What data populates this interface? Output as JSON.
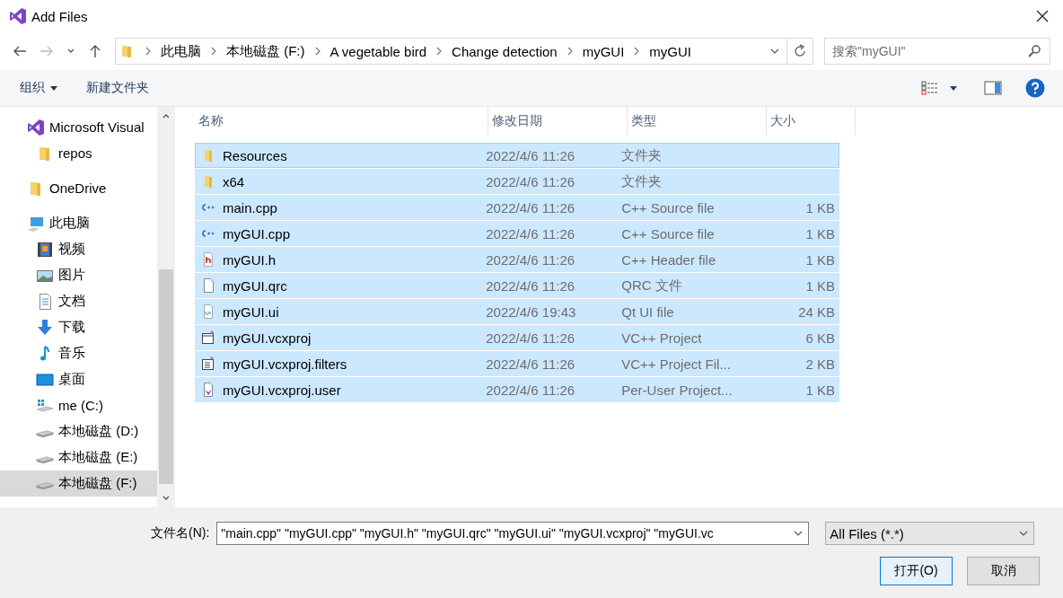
{
  "window": {
    "title": "Add Files"
  },
  "address": {
    "crumbs": [
      "此电脑",
      "本地磁盘 (F:)",
      "A vegetable bird",
      "Change detection",
      "myGUI",
      "myGUI"
    ]
  },
  "search": {
    "placeholder": "搜索\"myGUI\""
  },
  "toolbar": {
    "organize": "组织",
    "new_folder": "新建文件夹"
  },
  "sidebar": {
    "items": [
      {
        "label": "Microsoft Visual",
        "kind": "vs",
        "selected": false,
        "children": [
          {
            "label": "repos",
            "kind": "folder",
            "selected": false
          }
        ]
      },
      {
        "label": "OneDrive",
        "kind": "folder",
        "selected": false
      },
      {
        "label": "此电脑",
        "kind": "pc",
        "selected": false,
        "children": [
          {
            "label": "视频",
            "kind": "video",
            "selected": false
          },
          {
            "label": "图片",
            "kind": "picture",
            "selected": false
          },
          {
            "label": "文档",
            "kind": "doc",
            "selected": false
          },
          {
            "label": "下载",
            "kind": "download",
            "selected": false
          },
          {
            "label": "音乐",
            "kind": "music",
            "selected": false
          },
          {
            "label": "桌面",
            "kind": "desktop",
            "selected": false
          },
          {
            "label": "me (C:)",
            "kind": "windrive",
            "selected": false
          },
          {
            "label": "本地磁盘 (D:)",
            "kind": "drive",
            "selected": false
          },
          {
            "label": "本地磁盘 (E:)",
            "kind": "drive",
            "selected": false
          },
          {
            "label": "本地磁盘 (F:)",
            "kind": "drive",
            "selected": true
          }
        ]
      }
    ]
  },
  "table": {
    "columns": [
      "名称",
      "修改日期",
      "类型",
      "大小"
    ],
    "rows": [
      {
        "name": "Resources",
        "kind": "folder",
        "date": "2022/4/6 11:26",
        "type": "文件夹",
        "size": "",
        "selected": true
      },
      {
        "name": "x64",
        "kind": "folder",
        "date": "2022/4/6 11:26",
        "type": "文件夹",
        "size": "",
        "selected": true
      },
      {
        "name": "main.cpp",
        "kind": "cpp",
        "date": "2022/4/6 11:26",
        "type": "C++ Source file",
        "size": "1 KB",
        "selected": true
      },
      {
        "name": "myGUI.cpp",
        "kind": "cpp",
        "date": "2022/4/6 11:26",
        "type": "C++ Source file",
        "size": "1 KB",
        "selected": true
      },
      {
        "name": "myGUI.h",
        "kind": "h",
        "date": "2022/4/6 11:26",
        "type": "C++ Header file",
        "size": "1 KB",
        "selected": true
      },
      {
        "name": "myGUI.qrc",
        "kind": "qrc",
        "date": "2022/4/6 11:26",
        "type": "QRC 文件",
        "size": "1 KB",
        "selected": true
      },
      {
        "name": "myGUI.ui",
        "kind": "ui",
        "date": "2022/4/6 19:43",
        "type": "Qt UI file",
        "size": "24 KB",
        "selected": true
      },
      {
        "name": "myGUI.vcxproj",
        "kind": "vcxproj",
        "date": "2022/4/6 11:26",
        "type": "VC++ Project",
        "size": "6 KB",
        "selected": true
      },
      {
        "name": "myGUI.vcxproj.filters",
        "kind": "filters",
        "date": "2022/4/6 11:26",
        "type": "VC++ Project Fil...",
        "size": "2 KB",
        "selected": true
      },
      {
        "name": "myGUI.vcxproj.user",
        "kind": "user",
        "date": "2022/4/6 11:26",
        "type": "Per-User Project...",
        "size": "1 KB",
        "selected": true
      }
    ]
  },
  "footer": {
    "filename_label": "文件名(N):",
    "filename_value": "\"main.cpp\" \"myGUI.cpp\" \"myGUI.h\" \"myGUI.qrc\" \"myGUI.ui\" \"myGUI.vcxproj\" \"myGUI.vc",
    "filter": "All Files (*.*)",
    "open": "打开(O)",
    "cancel": "取消"
  }
}
